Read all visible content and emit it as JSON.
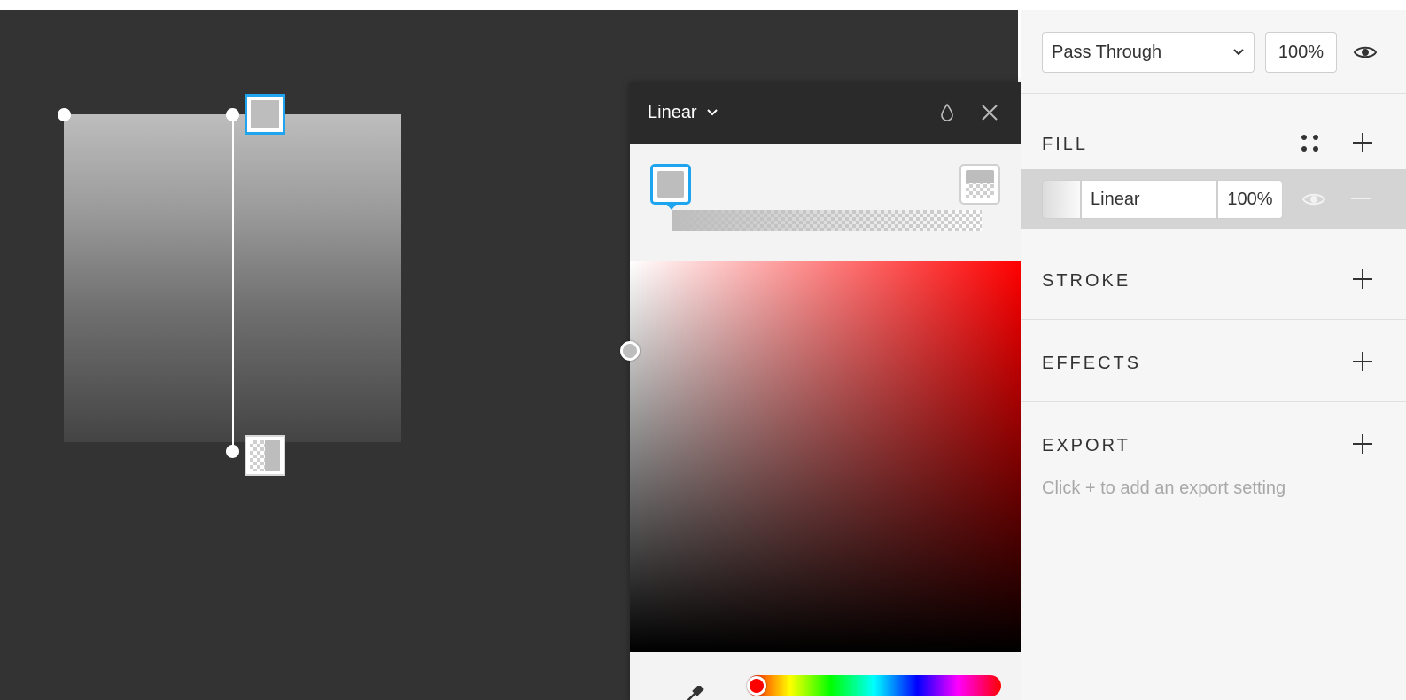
{
  "canvas": {
    "shape_gradient": {
      "start_color": "#bdbdbd",
      "end_color": "#444444"
    },
    "background": "#333333"
  },
  "picker": {
    "type_label": "Linear",
    "icons": {
      "type_chevron": "chevron-down-icon",
      "drop": "drop-icon",
      "close": "close-icon",
      "eyedropper": "eyedropper-icon"
    },
    "stop_color": "#bdbdbd",
    "hue_color": "#ff0000",
    "accent": "#1fa4f0"
  },
  "inspector": {
    "layer": {
      "blend_mode": "Pass Through",
      "opacity": "100%"
    },
    "fill": {
      "title": "FILL",
      "type": "Linear",
      "opacity": "100%"
    },
    "stroke": {
      "title": "STROKE"
    },
    "effects": {
      "title": "EFFECTS"
    },
    "export": {
      "title": "EXPORT",
      "hint": "Click + to add an export setting"
    }
  }
}
